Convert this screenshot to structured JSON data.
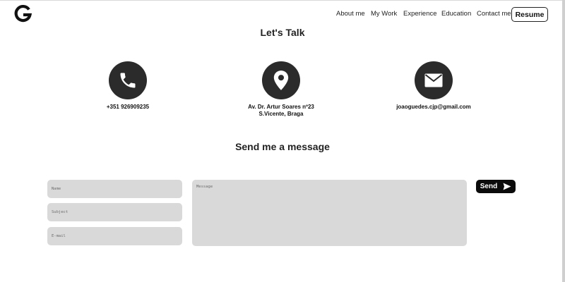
{
  "nav": {
    "logo_icon": "g-logo-icon",
    "links": [
      "About me",
      "My Work",
      "Experience",
      "Education",
      "Contact me"
    ],
    "resume_label": "Resume"
  },
  "contact": {
    "title": "Let's Talk",
    "items": [
      {
        "icon": "phone-icon",
        "lines": [
          "+351 926909235"
        ]
      },
      {
        "icon": "location-pin-icon",
        "lines": [
          "Av. Dr. Artur Soares nº23",
          "S.Vicente, Braga"
        ]
      },
      {
        "icon": "envelope-icon",
        "lines": [
          "joaoguedes.cjp@gmail.com"
        ]
      }
    ]
  },
  "form": {
    "title": "Send me a message",
    "name_placeholder": "Name",
    "subject_placeholder": "Subject",
    "email_placeholder": "E-mail",
    "message_placeholder": "Message",
    "send_label": "Send",
    "send_icon": "send-arrow-icon"
  },
  "colors": {
    "icon_circle": "#2b2b2b",
    "field_bg": "#d9d9d9",
    "send_bg": "#0b0b0b"
  }
}
